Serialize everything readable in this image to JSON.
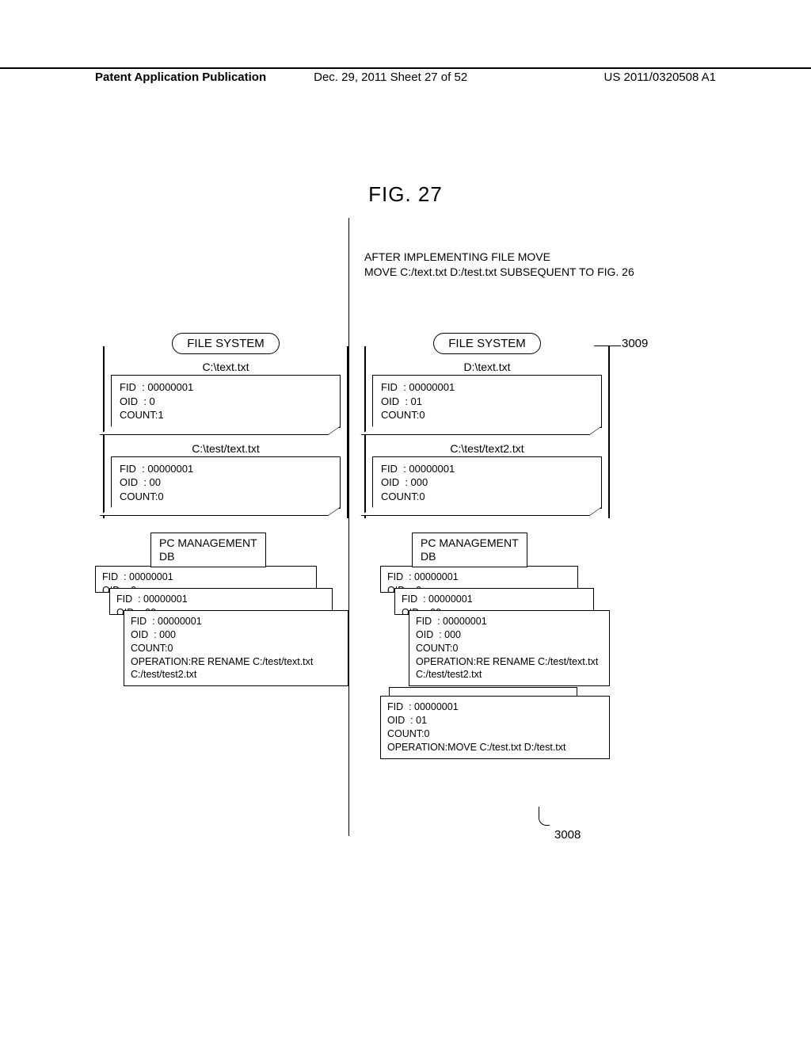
{
  "header": {
    "left": "Patent Application Publication",
    "center": "Dec. 29, 2011  Sheet 27 of 52",
    "right": "US 2011/0320508 A1"
  },
  "figure_title": "FIG. 27",
  "caption": "AFTER IMPLEMENTING FILE MOVE\nMOVE C:/text.txt D:/test.txt SUBSEQUENT TO FIG. 26",
  "refs": {
    "r3009": "3009",
    "r3008": "3008"
  },
  "left": {
    "fs_label": "FILE SYSTEM",
    "file1": {
      "path": "C:\\text.txt",
      "fid": "FID  : 00000001",
      "oid": "OID  : 0",
      "count": "COUNT:1"
    },
    "file2": {
      "path": "C:\\test/text.txt",
      "fid": "FID  : 00000001",
      "oid": "OID  : 00",
      "count": "COUNT:0"
    },
    "pc_label": "PC MANAGEMENT\nDB",
    "db": {
      "c1": "FID  : 00000001\nOID  : 0",
      "c2": "FID  : 00000001\nOID  : 00",
      "c3": "FID  : 00000001\nOID  : 000\nCOUNT:0\nOPERATION:RE RENAME C:/test/text.txt\nC:/test/test2.txt"
    }
  },
  "right": {
    "fs_label": "FILE SYSTEM",
    "file1": {
      "path": "D:\\text.txt",
      "fid": "FID  : 00000001",
      "oid": "OID  : 01",
      "count": "COUNT:0"
    },
    "file2": {
      "path": "C:\\test/text2.txt",
      "fid": "FID  : 00000001",
      "oid": "OID  : 000",
      "count": "COUNT:0"
    },
    "pc_label": "PC MANAGEMENT\nDB",
    "db": {
      "c1": "FID  : 00000001\nOID  : 0",
      "c2": "FID  : 00000001\nOID  : 00",
      "c3": "FID  : 00000001\nOID  : 000\nCOUNT:0\nOPERATION:RE RENAME C:/test/text.txt\nC:/test/test2.txt",
      "c4": "FID  : 00000001\nOID  : 01\nCOUNT:0\nOPERATION:MOVE C:/test.txt D:/test.txt"
    }
  }
}
